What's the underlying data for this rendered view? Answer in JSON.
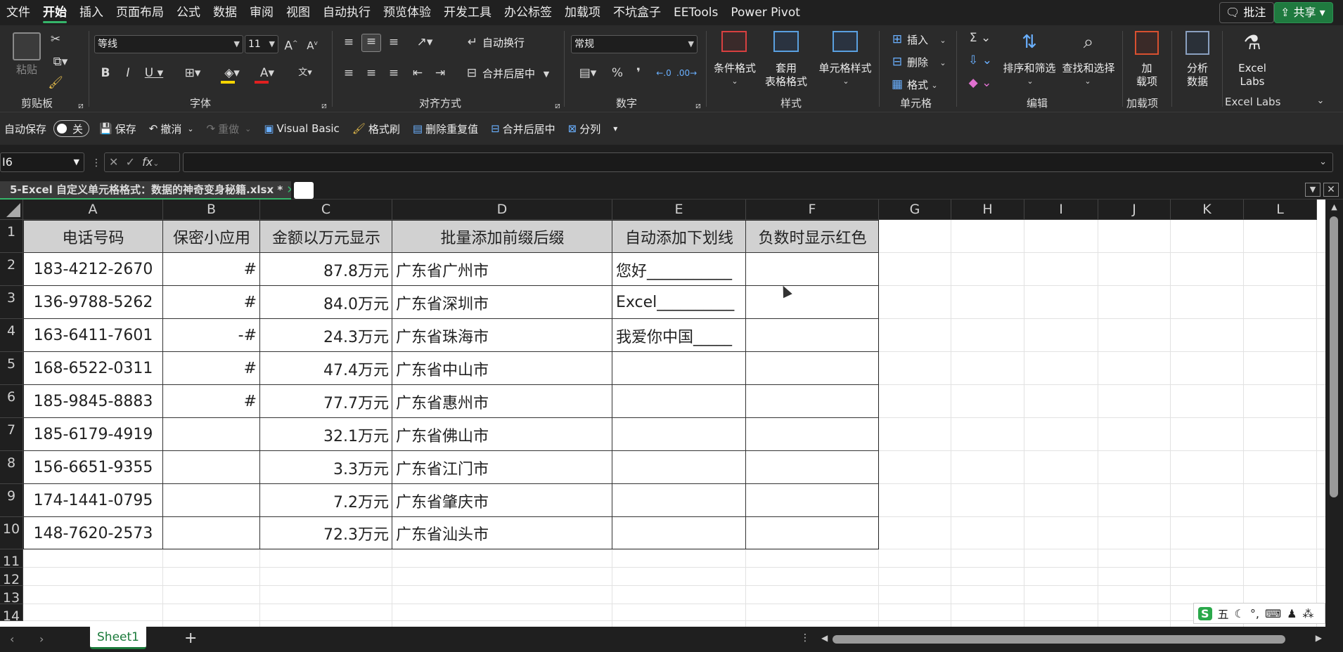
{
  "menu": {
    "items": [
      "文件",
      "开始",
      "插入",
      "页面布局",
      "公式",
      "数据",
      "审阅",
      "视图",
      "自动执行",
      "预览体验",
      "开发工具",
      "办公标签",
      "加载项",
      "不坑盒子",
      "EETools",
      "Power Pivot"
    ],
    "active": "开始",
    "comment_btn": "批注",
    "share_btn": "共享"
  },
  "ribbon": {
    "clipboard": {
      "label": "剪贴板",
      "paste": "粘贴"
    },
    "font": {
      "label": "字体",
      "font_name": "等线",
      "font_size": "11"
    },
    "alignment": {
      "label": "对齐方式",
      "wrap": "自动换行",
      "merge": "合并后居中"
    },
    "number": {
      "label": "数字",
      "format": "常规"
    },
    "styles": {
      "label": "样式",
      "cond_format": "条件格式",
      "table_format_1": "套用",
      "table_format_2": "表格格式",
      "cell_styles": "单元格样式"
    },
    "cells": {
      "label": "单元格",
      "insert": "插入",
      "delete": "删除",
      "format": "格式"
    },
    "editing": {
      "label": "编辑",
      "sort_filter": "排序和筛选",
      "find_select": "查找和选择"
    },
    "addins": {
      "label": "加载项",
      "btn_1": "加",
      "btn_2": "载项"
    },
    "analysis": {
      "btn_1": "分析",
      "btn_2": "数据"
    },
    "excel_labs": {
      "label": "Excel Labs",
      "btn_1": "Excel",
      "btn_2": "Labs"
    }
  },
  "qat": {
    "autosave": "自动保存",
    "toggle": "关",
    "save": "保存",
    "undo": "撤消",
    "redo": "重做",
    "vb": "Visual Basic",
    "format_painter": "格式刷",
    "remove_dup": "删除重复值",
    "merge_center": "合并后居中",
    "split": "分列"
  },
  "formula_bar": {
    "name_box": "I6",
    "fx": "fx",
    "content": ""
  },
  "workbook_tab": {
    "title": "5-Excel 自定义单元格格式：数据的神奇变身秘籍.xlsx *"
  },
  "columns": [
    "A",
    "B",
    "C",
    "D",
    "E",
    "F",
    "G",
    "H",
    "I",
    "J",
    "K",
    "L"
  ],
  "rows": [
    "1",
    "2",
    "3",
    "4",
    "5",
    "6",
    "7",
    "8",
    "9",
    "10",
    "11",
    "12",
    "13",
    "14"
  ],
  "headers": [
    "电话号码",
    "保密小应用",
    "金额以万元显示",
    "批量添加前缀后缀",
    "自动添加下划线",
    "负数时显示红色"
  ],
  "data": [
    {
      "a": "183-4212-2670",
      "b": "#",
      "c": "87.8万元",
      "d": "广东省广州市",
      "e": "您好___________",
      "f": ""
    },
    {
      "a": "136-9788-5262",
      "b": "#",
      "c": "84.0万元",
      "d": "广东省深圳市",
      "e": "Excel__________",
      "f": ""
    },
    {
      "a": "163-6411-7601",
      "b": "-#",
      "c": "24.3万元",
      "d": "广东省珠海市",
      "e": "我爱你中国_____",
      "f": ""
    },
    {
      "a": "168-6522-0311",
      "b": "#",
      "c": "47.4万元",
      "d": "广东省中山市",
      "e": "",
      "f": ""
    },
    {
      "a": "185-9845-8883",
      "b": "#",
      "c": "77.7万元",
      "d": "广东省惠州市",
      "e": "",
      "f": ""
    },
    {
      "a": "185-6179-4919",
      "b": "",
      "c": "32.1万元",
      "d": "广东省佛山市",
      "e": "",
      "f": ""
    },
    {
      "a": "156-6651-9355",
      "b": "",
      "c": "3.3万元",
      "d": "广东省江门市",
      "e": "",
      "f": ""
    },
    {
      "a": "174-1441-0795",
      "b": "",
      "c": "7.2万元",
      "d": "广东省肇庆市",
      "e": "",
      "f": ""
    },
    {
      "a": "148-7620-2573",
      "b": "",
      "c": "72.3万元",
      "d": "广东省汕头市",
      "e": "",
      "f": ""
    }
  ],
  "sheet": {
    "active": "Sheet1"
  },
  "ime": {
    "mode": "五"
  }
}
